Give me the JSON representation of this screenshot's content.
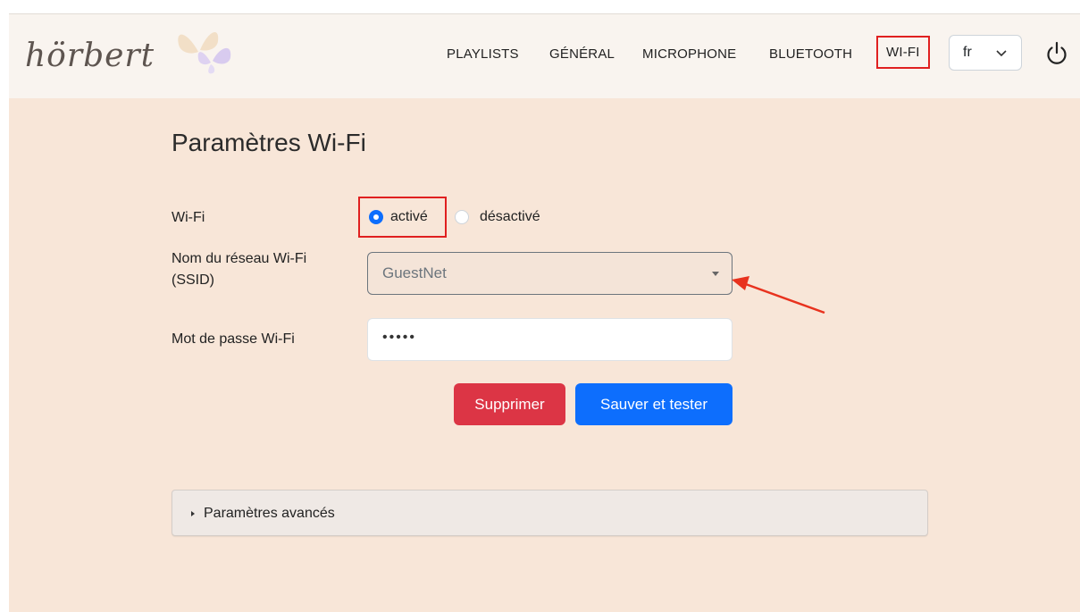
{
  "brand": {
    "logo_text": "hörbert"
  },
  "nav": {
    "items": [
      "PLAYLISTS",
      "GÉNÉRAL",
      "MICROPHONE",
      "BLUETOOTH",
      "WI-FI"
    ],
    "active": "WI-FI",
    "language": "fr"
  },
  "page": {
    "title": "Paramètres Wi-Fi"
  },
  "form": {
    "wifi_label": "Wi-Fi",
    "wifi_on_label": "activé",
    "wifi_off_label": "désactivé",
    "wifi_selected": "activé",
    "ssid_label_line1": "Nom du réseau Wi-Fi",
    "ssid_label_line2": "(SSID)",
    "ssid_value": "GuestNet",
    "password_label": "Mot de passe Wi-Fi",
    "password_value": "•••••",
    "delete_button": "Supprimer",
    "save_button": "Sauver et tester"
  },
  "advanced": {
    "label": "Paramètres avancés"
  },
  "colors": {
    "page_bg": "#f8e6d8",
    "navbar_bg": "#f9f4ef",
    "primary": "#0d6efd",
    "danger": "#dc3545",
    "annotation": "#e02020"
  }
}
